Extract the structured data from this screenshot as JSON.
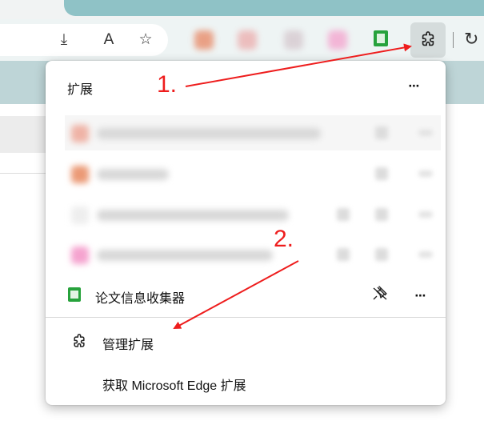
{
  "flyout": {
    "title": "扩展",
    "more_label": "⋯",
    "extension": {
      "name": "论文信息收集器",
      "pin_glyph": "⚲",
      "more_label": "⋯"
    },
    "manage_label": "管理扩展",
    "get_label": "获取 Microsoft Edge 扩展"
  },
  "annotations": {
    "step1": "1.",
    "step2": "2."
  },
  "colors": {
    "arrow": "#ee1d1d",
    "extension_green": "#27a23c",
    "toolbar_tint": "#bed5d7"
  },
  "icons": [
    "download-icon",
    "read-aloud-icon",
    "favorite-star-icon",
    "extensions-puzzle-icon",
    "pin-off-icon",
    "more-icon"
  ]
}
